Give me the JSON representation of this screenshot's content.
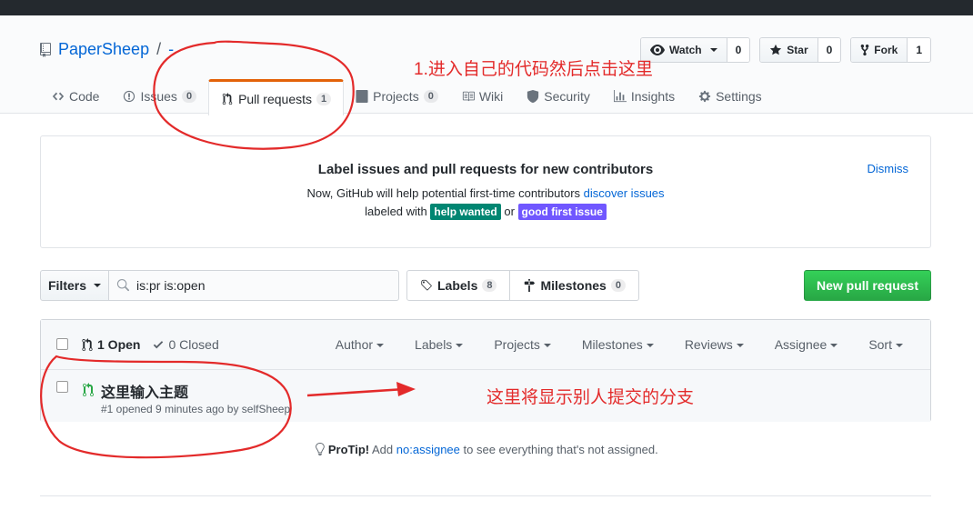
{
  "repo": {
    "owner": "PaperSheep",
    "separator": "/",
    "name": "-"
  },
  "actions": {
    "watch": {
      "label": "Watch",
      "count": "0"
    },
    "star": {
      "label": "Star",
      "count": "0"
    },
    "fork": {
      "label": "Fork",
      "count": "1"
    }
  },
  "tabs": [
    {
      "label": "Code",
      "count": ""
    },
    {
      "label": "Issues",
      "count": "0"
    },
    {
      "label": "Pull requests",
      "count": "1"
    },
    {
      "label": "Projects",
      "count": "0"
    },
    {
      "label": "Wiki",
      "count": ""
    },
    {
      "label": "Security",
      "count": ""
    },
    {
      "label": "Insights",
      "count": ""
    },
    {
      "label": "Settings",
      "count": ""
    }
  ],
  "annotations": {
    "step1": "1.进入自己的代码然后点击这里",
    "branch_note": "这里将显示别人提交的分支"
  },
  "banner": {
    "title": "Label issues and pull requests for new contributors",
    "desc_prefix": "Now, GitHub will help potential first-time contributors",
    "desc_link": "discover issues",
    "line2_prefix": "labeled with",
    "label_help": "help wanted",
    "label_or": "or",
    "label_good": "good first issue",
    "dismiss": "Dismiss",
    "colors": {
      "help": "#008672",
      "good": "#7057ff"
    }
  },
  "filterbar": {
    "filters": "Filters",
    "search_value": "is:pr is:open",
    "labels": "Labels",
    "labels_count": "8",
    "milestones": "Milestones",
    "milestones_count": "0",
    "new_pr": "New pull request"
  },
  "list": {
    "open": "1 Open",
    "closed": "0 Closed",
    "filters": [
      "Author",
      "Labels",
      "Projects",
      "Milestones",
      "Reviews",
      "Assignee",
      "Sort"
    ],
    "items": [
      {
        "title": "这里输入主题",
        "meta": "#1 opened 9 minutes ago by selfSheep"
      }
    ]
  },
  "protip": {
    "lead": "ProTip!",
    "text1": "Add",
    "link": "no:assignee",
    "text2": "to see everything that's not assigned."
  }
}
